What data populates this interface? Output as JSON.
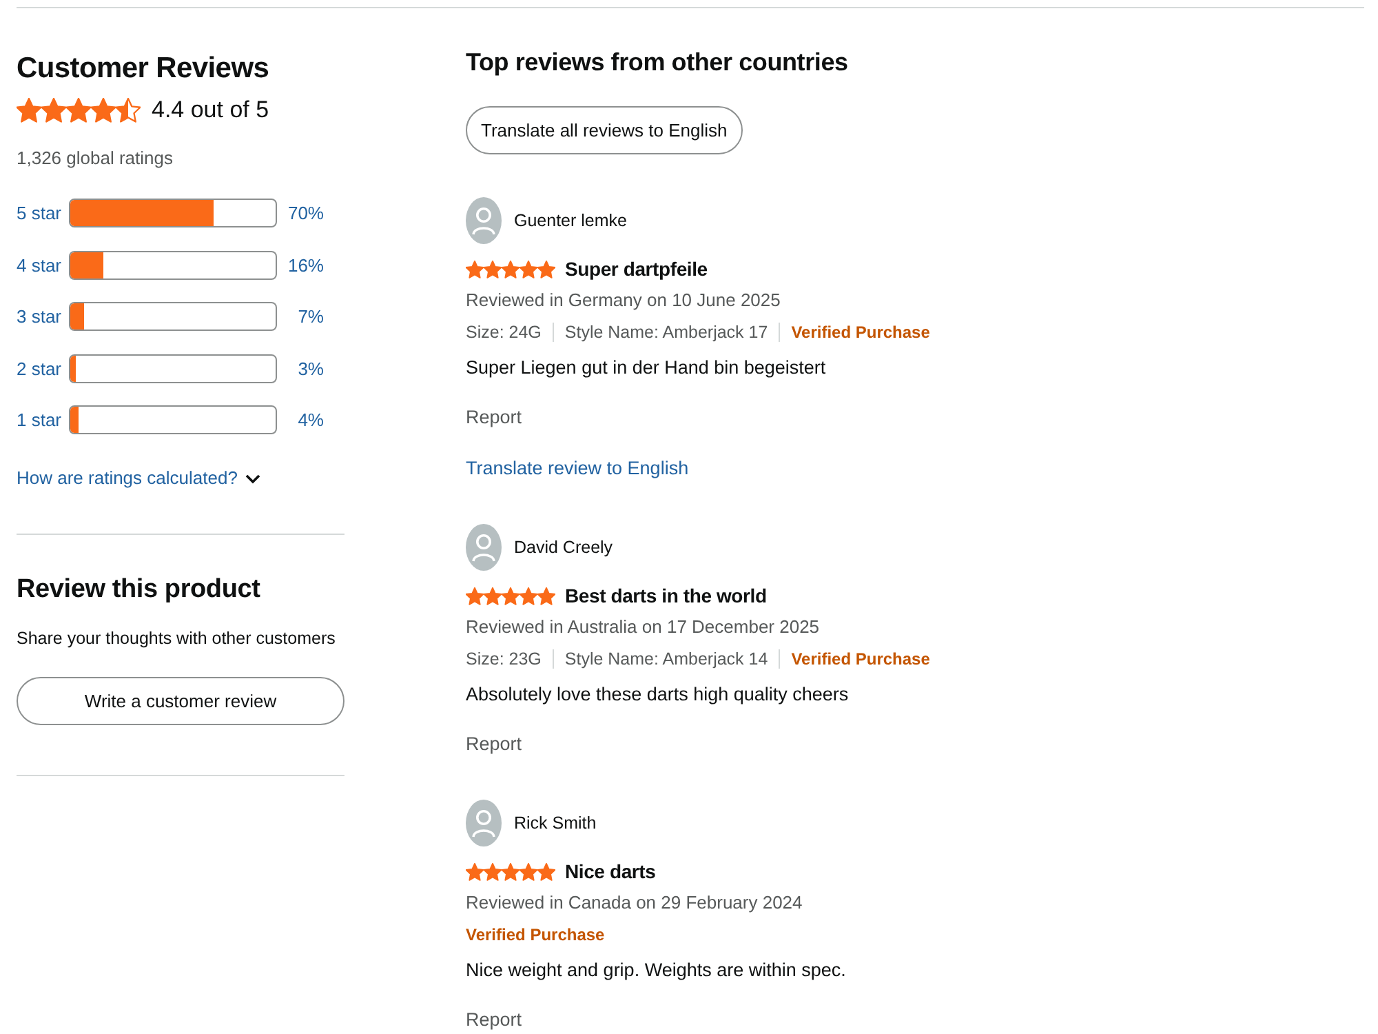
{
  "summary": {
    "title": "Customer Reviews",
    "stars": 4.5,
    "rating": "4.4 out of 5",
    "total": "1,326 global ratings"
  },
  "histogram": [
    {
      "label": "5 star",
      "level": 0.7,
      "percent": "70%"
    },
    {
      "label": "4 star",
      "level": 0.16,
      "percent": "16%"
    },
    {
      "label": "3 star",
      "level": 0.07,
      "percent": "7%"
    },
    {
      "label": "2 star",
      "level": 0.03,
      "percent": "3%"
    },
    {
      "label": "1 star",
      "level": 0.04,
      "percent": "4%"
    }
  ],
  "ratings_help": {
    "label": "How are ratings calculated?"
  },
  "review_product": {
    "title": "Review this product",
    "text": "Share your thoughts with other customers",
    "button": "Write a customer review"
  },
  "reviews_section": {
    "title": "Top reviews from other countries",
    "translate_all": "Translate all reviews to English"
  },
  "reviews": [
    {
      "author": "Guenter lemke",
      "stars": 5,
      "title": "Super dartpfeile",
      "meta": "Reviewed in Germany on 10 June 2025",
      "size": "Size: 24G",
      "style": "Style Name: Amberjack 17",
      "verified": "Verified Purchase",
      "body": "Super Liegen gut in der Hand bin begeistert",
      "report": "Report",
      "translate": "Translate review to English"
    },
    {
      "author": "David Creely",
      "stars": 5,
      "title": "Best darts in the world",
      "meta": "Reviewed in Australia on 17 December 2025",
      "size": "Size: 23G",
      "style": "Style Name: Amberjack 14",
      "verified": "Verified Purchase",
      "body": "Absolutely love these darts high quality cheers",
      "report": "Report"
    },
    {
      "author": "Rick Smith",
      "stars": 5,
      "title": "Nice darts",
      "meta": "Reviewed in Canada on 29 February 2024",
      "verified": "Verified Purchase",
      "body": "Nice weight and grip. Weights are within spec.",
      "report": "Report"
    }
  ]
}
